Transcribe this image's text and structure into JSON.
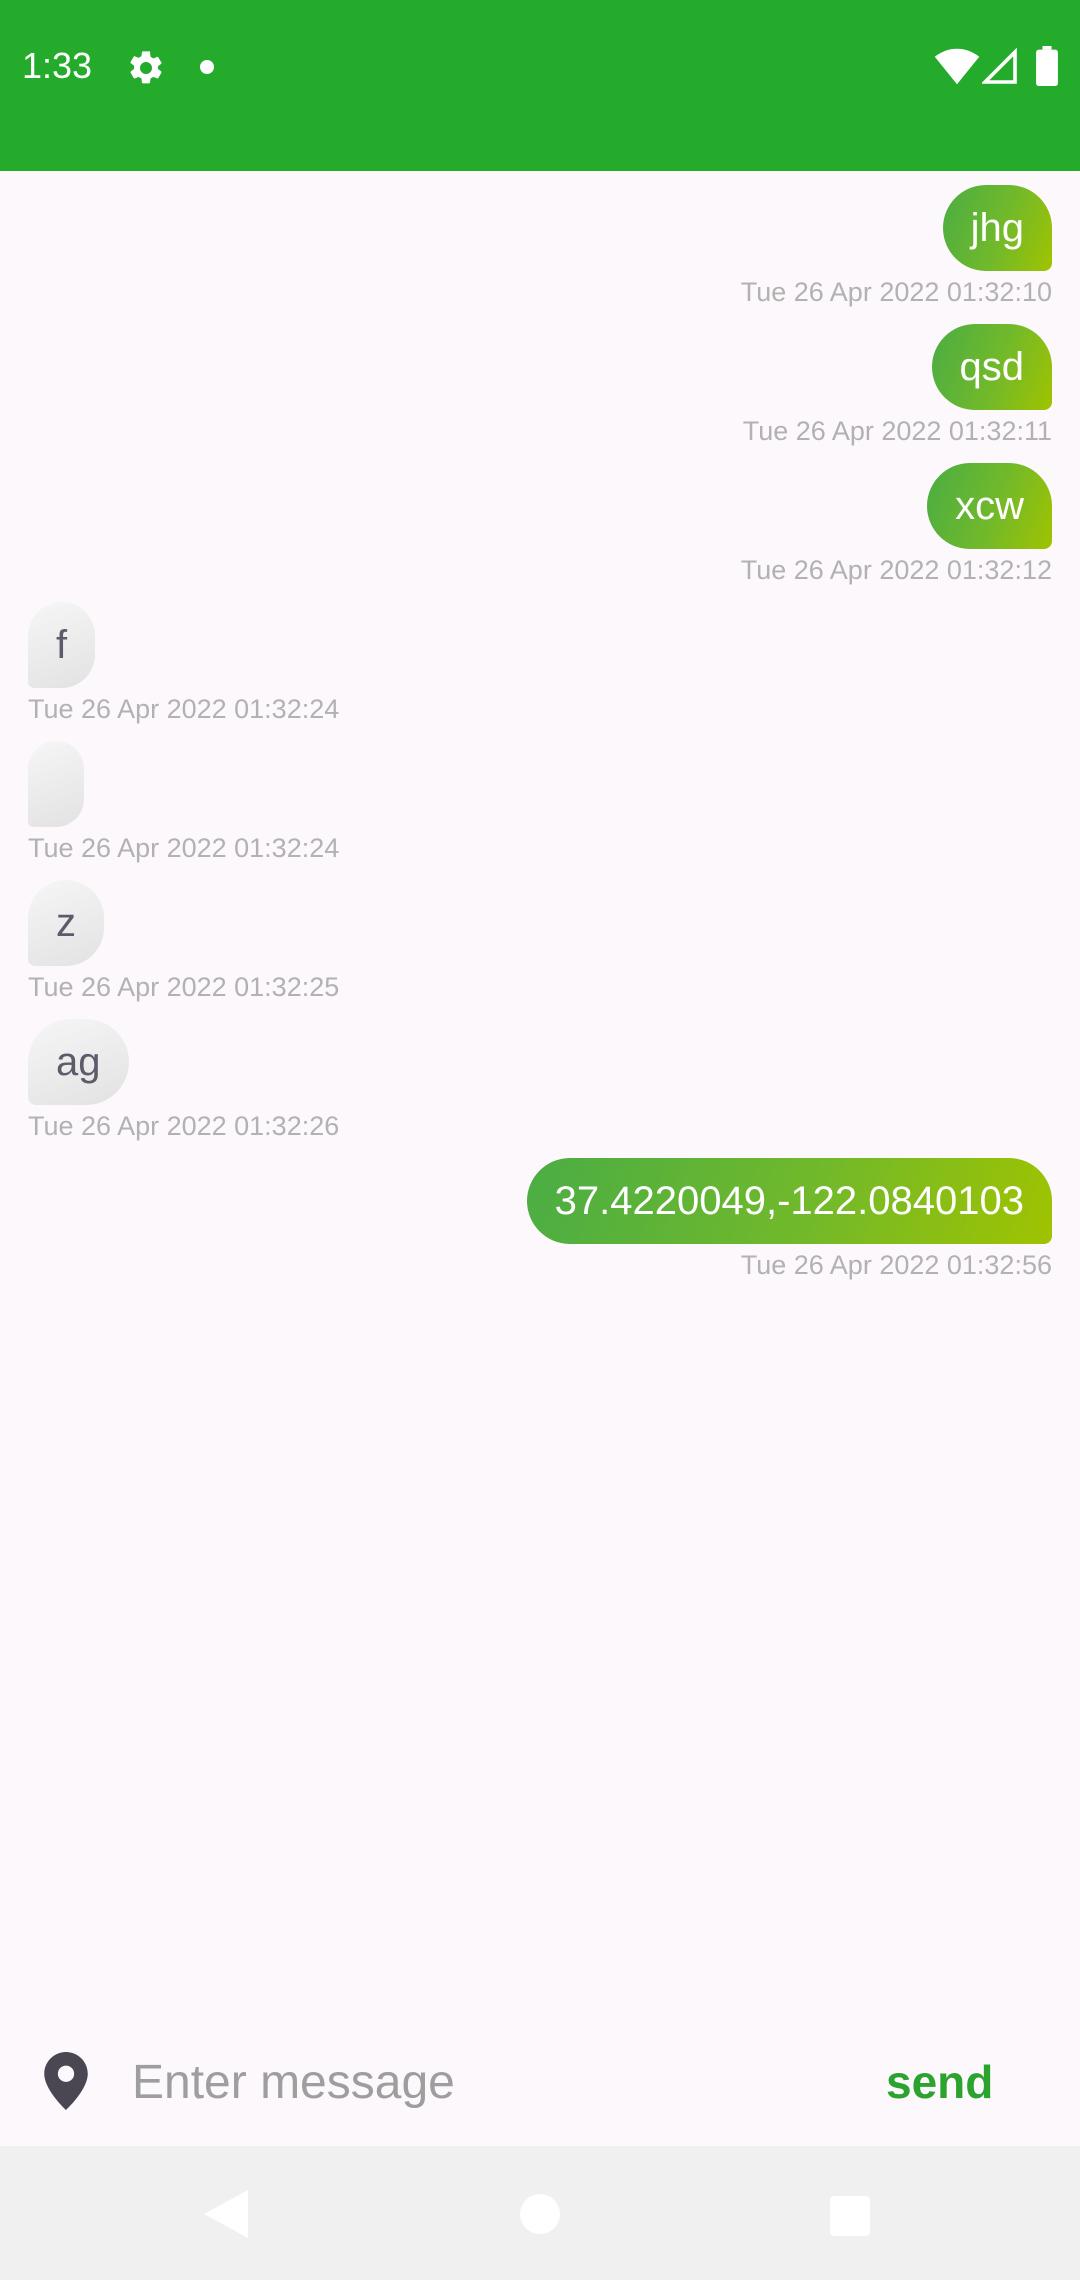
{
  "status_bar": {
    "time": "1:33",
    "icons": [
      "gear-icon",
      "notification-dot",
      "wifi-icon",
      "signal-icon",
      "battery-icon"
    ],
    "background_color": "#24ab2c"
  },
  "messages": [
    {
      "direction": "outgoing",
      "text": "jhg",
      "timestamp": "Tue 26 Apr 2022 01:32:10"
    },
    {
      "direction": "outgoing",
      "text": "qsd",
      "timestamp": "Tue 26 Apr 2022 01:32:11"
    },
    {
      "direction": "outgoing",
      "text": "xcw",
      "timestamp": "Tue 26 Apr 2022 01:32:12"
    },
    {
      "direction": "incoming",
      "text": "f",
      "timestamp": "Tue 26 Apr 2022 01:32:24"
    },
    {
      "direction": "incoming",
      "text": "",
      "timestamp": "Tue 26 Apr 2022 01:32:24"
    },
    {
      "direction": "incoming",
      "text": "z",
      "timestamp": "Tue 26 Apr 2022 01:32:25"
    },
    {
      "direction": "incoming",
      "text": "ag",
      "timestamp": "Tue 26 Apr 2022 01:32:26"
    },
    {
      "direction": "outgoing",
      "text": "37.4220049,-122.0840103",
      "timestamp": "Tue 26 Apr 2022 01:32:56"
    }
  ],
  "composer": {
    "placeholder": "Enter message",
    "value": "",
    "send_label": "send",
    "location_icon": "location-pin-icon"
  },
  "nav_bar": {
    "icons": [
      "back-icon",
      "home-icon",
      "recents-icon"
    ]
  },
  "colors": {
    "accent_green": "#24ab2c",
    "send_text": "#2ca32f",
    "outgoing_gradient_start": "#4aad44",
    "outgoing_gradient_end": "#a0c300",
    "timestamp_gray": "#b2b2b2"
  }
}
